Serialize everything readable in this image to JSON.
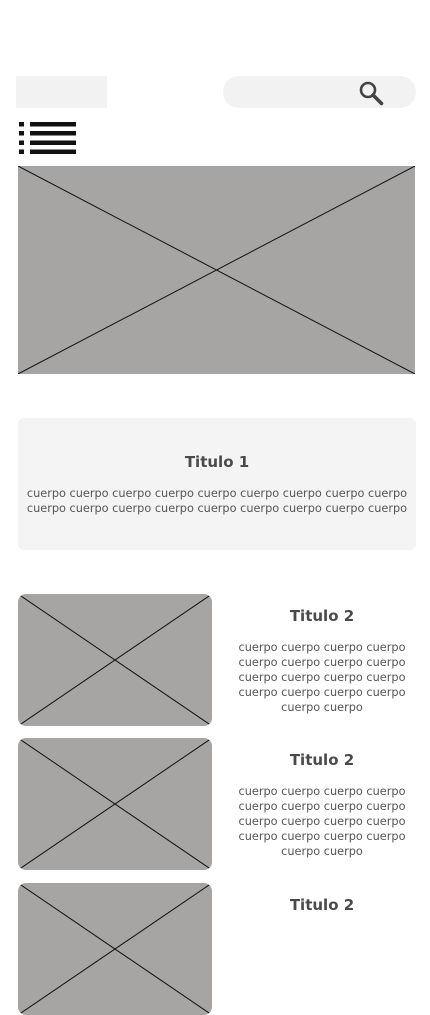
{
  "header": {
    "logo_placeholder": "logo-placeholder",
    "search_icon": "search-icon",
    "menu_icon": "list-menu-icon"
  },
  "hero": {
    "image": "image-placeholder"
  },
  "feature_card": {
    "title": "Titulo 1",
    "body": "cuerpo cuerpo cuerpo cuerpo cuerpo cuerpo  cuerpo cuerpo cuerpo cuerpo cuerpo cuerpo cuerpo cuerpo cuerpo cuerpo cuerpo cuerpo"
  },
  "items": [
    {
      "title": "Titulo 2",
      "body": "cuerpo cuerpo cuerpo cuerpo cuerpo cuerpo  cuerpo cuerpo cuerpo cuerpo cuerpo cuerpo cuerpo cuerpo cuerpo cuerpo cuerpo cuerpo"
    },
    {
      "title": "Titulo 2",
      "body": "cuerpo cuerpo cuerpo cuerpo cuerpo cuerpo  cuerpo cuerpo cuerpo cuerpo cuerpo cuerpo cuerpo cuerpo cuerpo cuerpo cuerpo cuerpo"
    },
    {
      "title": "Titulo 2"
    }
  ],
  "colors": {
    "placeholder_fill": "#a6a5a3",
    "card_background": "#f4f4f4",
    "text": "#4a4a4a"
  }
}
